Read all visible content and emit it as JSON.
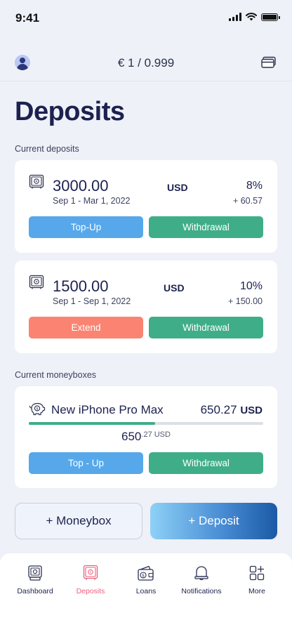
{
  "status_bar": {
    "time": "9:41"
  },
  "header": {
    "balance": "€ 1 / 0.999",
    "profile_icon": "user-avatar-icon",
    "cards_icon": "cards-icon"
  },
  "page_title": "Deposits",
  "current_deposits_label": "Current deposits",
  "deposits": [
    {
      "amount": "3000.00",
      "period": "Sep 1 - Mar 1, 2022",
      "currency": "USD",
      "rate": "8%",
      "gain": "+ 60.57",
      "primary_action": "Top-Up",
      "secondary_action": "Withdrawal"
    },
    {
      "amount": "1500.00",
      "period": "Sep 1 - Sep 1, 2022",
      "currency": "USD",
      "rate": "10%",
      "gain": "+ 150.00",
      "primary_action": "Extend",
      "secondary_action": "Withdrawal"
    }
  ],
  "current_moneyboxes_label": "Current moneyboxes",
  "moneyboxes": [
    {
      "name": "New iPhone Pro Max",
      "target_amount": "650.27",
      "target_currency": "USD",
      "saved_whole": "650",
      "saved_fraction": ".27 USD",
      "progress_fraction": 0.54,
      "primary_action": "Top - Up",
      "secondary_action": "Withdrawal"
    }
  ],
  "actions": {
    "add_moneybox": "+ Moneybox",
    "add_deposit": "+ Deposit"
  },
  "tabs": [
    {
      "label": "Dashboard",
      "icon": "dashboard-icon",
      "active": false
    },
    {
      "label": "Deposits",
      "icon": "safe-icon",
      "active": true
    },
    {
      "label": "Loans",
      "icon": "wallet-icon",
      "active": false
    },
    {
      "label": "Notifications",
      "icon": "bell-icon",
      "active": false
    },
    {
      "label": "More",
      "icon": "grid-plus-icon",
      "active": false
    }
  ],
  "colors": {
    "accent_blue": "#56a8ea",
    "accent_green": "#3fae88",
    "accent_orange": "#fa8471",
    "active_tab": "#ec5f7e",
    "title": "#1c2150"
  }
}
